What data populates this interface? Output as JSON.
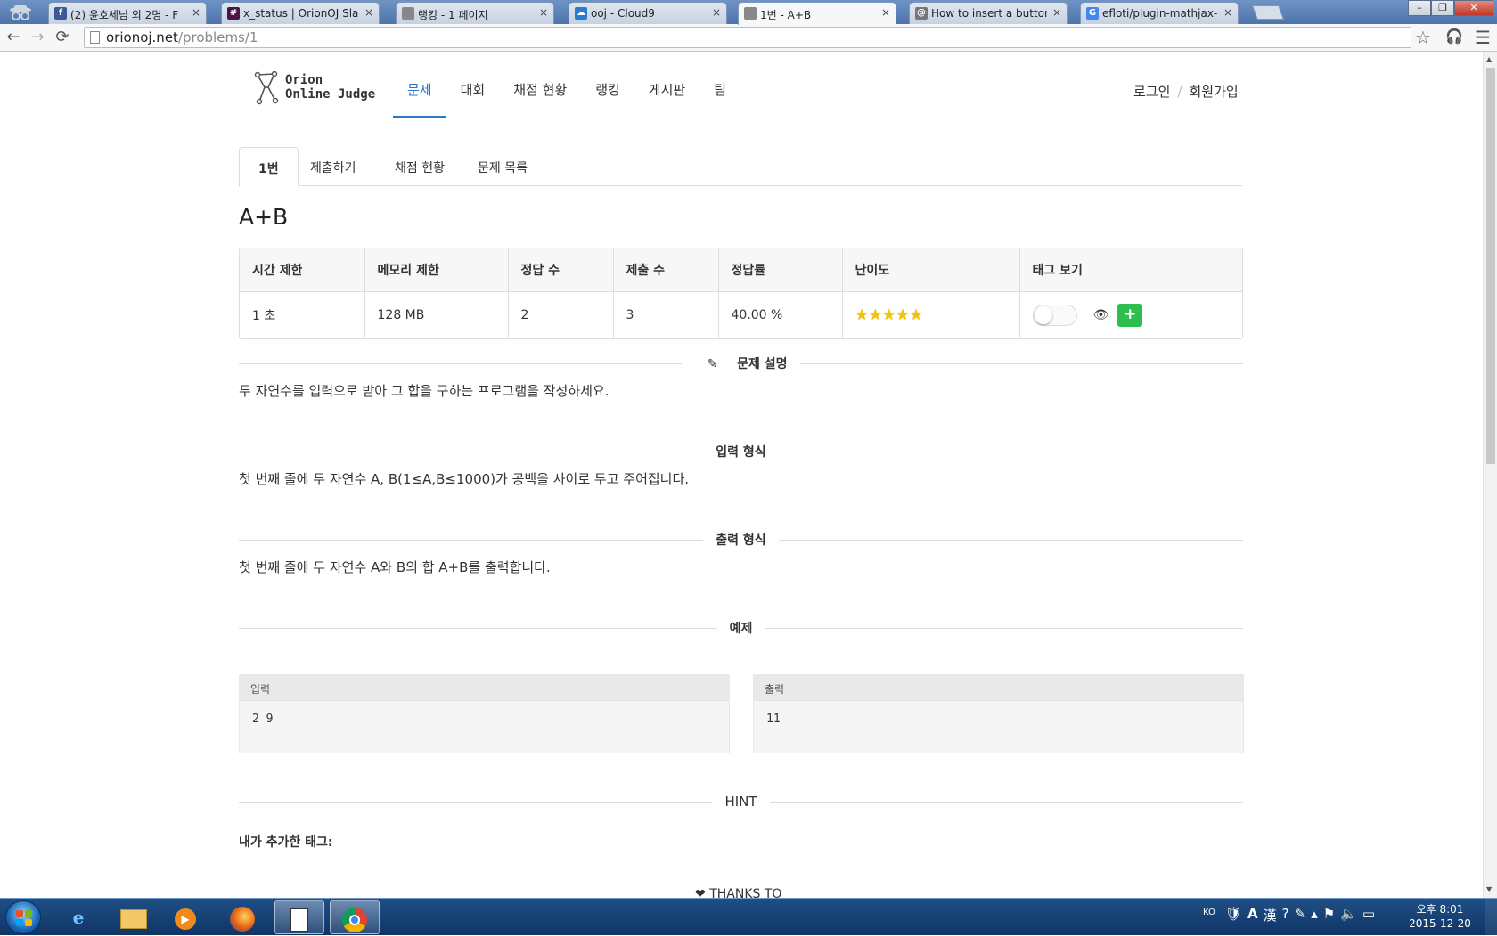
{
  "browser": {
    "tabs": [
      {
        "title": "(2) 윤호세님 외 2명 - F",
        "icon": "facebook-icon",
        "color": "#3b5998",
        "glyph": "f"
      },
      {
        "title": "x_status | OrionOJ Slack",
        "icon": "slack-icon",
        "color": "#4a154b",
        "glyph": "#"
      },
      {
        "title": "랭킹 - 1 페이지",
        "icon": "page-icon",
        "color": "#888888",
        "glyph": ""
      },
      {
        "title": "ooj - Cloud9",
        "icon": "cloud9-icon",
        "color": "#2a7bd0",
        "glyph": "☁"
      },
      {
        "title": "1번 - A+B",
        "icon": "page-icon",
        "color": "#888888",
        "glyph": ""
      },
      {
        "title": "How to insert a button in",
        "icon": "stackoverflow-icon",
        "color": "#777777",
        "glyph": "@"
      },
      {
        "title": "efloti/plugin-mathjax-pou",
        "icon": "google-icon",
        "color": "#4285f4",
        "glyph": "G"
      }
    ],
    "close_glyph": "×",
    "url_host": "orionoj.net",
    "url_path": "/problems/1",
    "window_controls": {
      "minimize": "–",
      "maximize": "❐",
      "close": "✕"
    }
  },
  "site": {
    "logo_text": "Orion\nOnline Judge",
    "nav": [
      {
        "label": "문제",
        "active": true
      },
      {
        "label": "대회",
        "active": false
      },
      {
        "label": "채점 현황",
        "active": false
      },
      {
        "label": "랭킹",
        "active": false
      },
      {
        "label": "게시판",
        "active": false
      },
      {
        "label": "팀",
        "active": false
      }
    ],
    "login": "로그인",
    "separator": "/",
    "signup": "회원가입"
  },
  "problem": {
    "tabs": [
      "1번",
      "제출하기",
      "채점 현황",
      "문제 목록"
    ],
    "title": "A+B",
    "info_headers": [
      "시간 제한",
      "메모리 제한",
      "정답 수",
      "제출 수",
      "정답률",
      "난이도",
      "태그 보기"
    ],
    "info_values": [
      "1 초",
      "128 MB",
      "2",
      "3",
      "40.00 %"
    ],
    "difficulty_stars": 5,
    "star_glyph": "★★★★★",
    "eye_glyph": "👁",
    "plus_glyph": "+",
    "sections": {
      "description_title": "문제 설명",
      "description": "두 자연수를 입력으로 받아 그 합을 구하는 프로그램을 작성하세요.",
      "input_title": "입력 형식",
      "input": "첫 번째 줄에 두 자연수 A, B(1≤A,B≤1000)가 공백을 사이로 두고 주어집니다.",
      "output_title": "출력 형식",
      "output": "첫 번째 줄에 두 자연수 A와 B의 합 A+B를 출력합니다.",
      "example_title": "예제",
      "sample_input_label": "입력",
      "sample_input": "2 9",
      "sample_output_label": "출력",
      "sample_output": "11",
      "hint_title": "HINT",
      "my_tags_label": "내가 추가한 태그:",
      "thanks_label": "THANKS TO"
    },
    "pencil_glyph": "✎",
    "heart_glyph": "❤"
  },
  "taskbar": {
    "lang": "KO",
    "clock_time": "오후 8:01",
    "clock_date": "2015-12-20",
    "colors": {
      "accent": "#2a78c8",
      "plus_green": "#2fbd4f",
      "star": "#f5c400"
    }
  }
}
